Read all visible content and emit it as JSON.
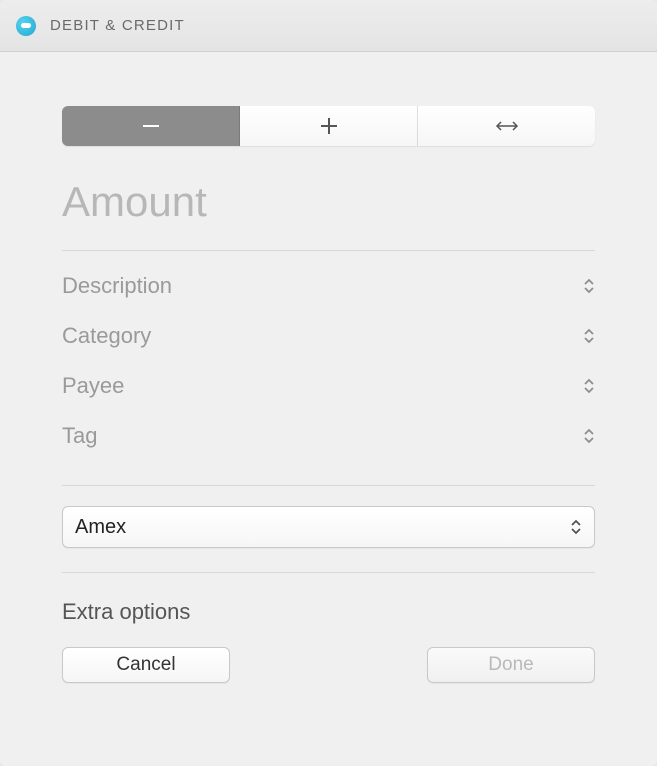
{
  "window": {
    "title": "DEBIT & CREDIT"
  },
  "segments": {
    "minus_icon": "minus-icon",
    "plus_icon": "plus-icon",
    "transfer_icon": "transfer-icon"
  },
  "amount": {
    "placeholder": "Amount",
    "value": ""
  },
  "fields": {
    "description": "Description",
    "category": "Category",
    "payee": "Payee",
    "tag": "Tag"
  },
  "account": {
    "selected": "Amex"
  },
  "extra": {
    "label": "Extra options"
  },
  "buttons": {
    "cancel": "Cancel",
    "done": "Done"
  }
}
